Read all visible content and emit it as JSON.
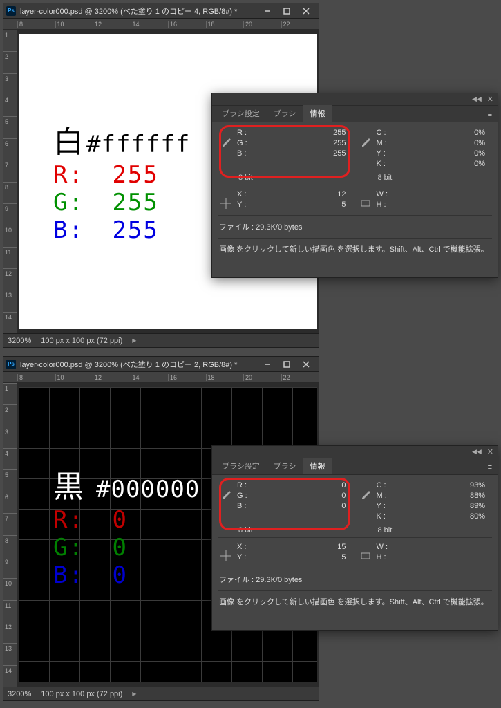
{
  "windows": [
    {
      "title": "layer-color000.psd @ 3200% (べた塗り 1 のコピー 4, RGB/8#) *",
      "ruler_h": [
        "8",
        "10",
        "12",
        "14",
        "16",
        "18",
        "20",
        "22"
      ],
      "ruler_v": [
        "1",
        "2",
        "3",
        "4",
        "5",
        "6",
        "7",
        "8",
        "9",
        "10",
        "11",
        "12",
        "13",
        "14"
      ],
      "zoom": "3200%",
      "dims": "100 px x 100 px (72 ppi)",
      "canvas": {
        "jp": "白",
        "hex": "#ffffff",
        "r_label": "R:",
        "r_val": "255",
        "g_label": "G:",
        "g_val": "255",
        "b_label": "B:",
        "b_val": "255"
      }
    },
    {
      "title": "layer-color000.psd @ 3200% (べた塗り 1 のコピー 2, RGB/8#) *",
      "ruler_h": [
        "8",
        "10",
        "12",
        "14",
        "16",
        "18",
        "20",
        "22"
      ],
      "ruler_v": [
        "1",
        "2",
        "3",
        "4",
        "5",
        "6",
        "7",
        "8",
        "9",
        "10",
        "11",
        "12",
        "13",
        "14"
      ],
      "zoom": "3200%",
      "dims": "100 px x 100 px (72 ppi)",
      "canvas": {
        "jp": "黒",
        "hex": "#000000",
        "r_label": "R:",
        "r_val": "0",
        "g_label": "G:",
        "g_val": "0",
        "b_label": "B:",
        "b_val": "0"
      }
    }
  ],
  "panel_tabs": {
    "t0": "ブラシ設定",
    "t1": "ブラシ",
    "t2": "情報"
  },
  "panels": [
    {
      "rgb": {
        "r": "255",
        "g": "255",
        "b": "255",
        "bits": "8 bit"
      },
      "cmyk": {
        "c": "0%",
        "m": "0%",
        "y": "0%",
        "k": "0%",
        "bits": "8 bit"
      },
      "xy": {
        "x": "12",
        "y": "5"
      },
      "wh": {
        "w": "",
        "h": ""
      },
      "file": "ファイル : 29.3K/0 bytes",
      "hint": "画像 をクリックして新しい描画色 を選択します。Shift、Alt、Ctrl で機能拡張。"
    },
    {
      "rgb": {
        "r": "0",
        "g": "0",
        "b": "0",
        "bits": "8 bit"
      },
      "cmyk": {
        "c": "93%",
        "m": "88%",
        "y": "89%",
        "k": "80%",
        "bits": "8 bit"
      },
      "xy": {
        "x": "15",
        "y": "5"
      },
      "wh": {
        "w": "",
        "h": ""
      },
      "file": "ファイル : 29.3K/0 bytes",
      "hint": "画像 をクリックして新しい描画色 を選択します。Shift、Alt、Ctrl で機能拡張。"
    }
  ],
  "labels": {
    "R": "R :",
    "G": "G :",
    "B": "B :",
    "C": "C :",
    "M": "M :",
    "Y": "Y :",
    "K": "K :",
    "X": "X :",
    "Y2": "Y :",
    "W": "W :",
    "H": "H :"
  }
}
